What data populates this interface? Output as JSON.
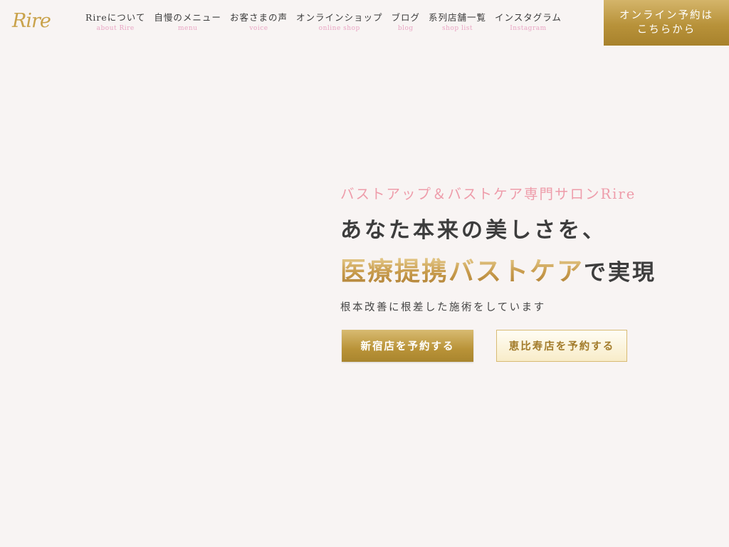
{
  "header": {
    "logo": "Rire",
    "nav": [
      {
        "jp": "Rireについて",
        "en": "about Rire"
      },
      {
        "jp": "自慢のメニュー",
        "en": "menu"
      },
      {
        "jp": "お客さまの声",
        "en": "voice"
      },
      {
        "jp": "オンラインショップ",
        "en": "online shop"
      },
      {
        "jp": "ブログ",
        "en": "blog"
      },
      {
        "jp": "系列店舗一覧",
        "en": "shop list"
      },
      {
        "jp": "インスタグラム",
        "en": "Instagram"
      }
    ],
    "reserve": {
      "line1": "オンライン予約は",
      "line2": "こちらから"
    }
  },
  "hero": {
    "subtitle": "バストアップ＆バストケア専門サロンRire",
    "line1": "あなた本来の美しさを、",
    "line2_gold": "医療提携バストケア",
    "line2_rest": "で実現",
    "description": "根本改善に根差した施術をしています",
    "buttons": {
      "shinjuku": "新宿店を予約する",
      "ebisu": "恵比寿店を予約する"
    }
  },
  "colors": {
    "background": "#f8f4f3",
    "gold": "#b8923a",
    "pink": "#ee9caa",
    "nav_en": "#e9a6c4"
  }
}
